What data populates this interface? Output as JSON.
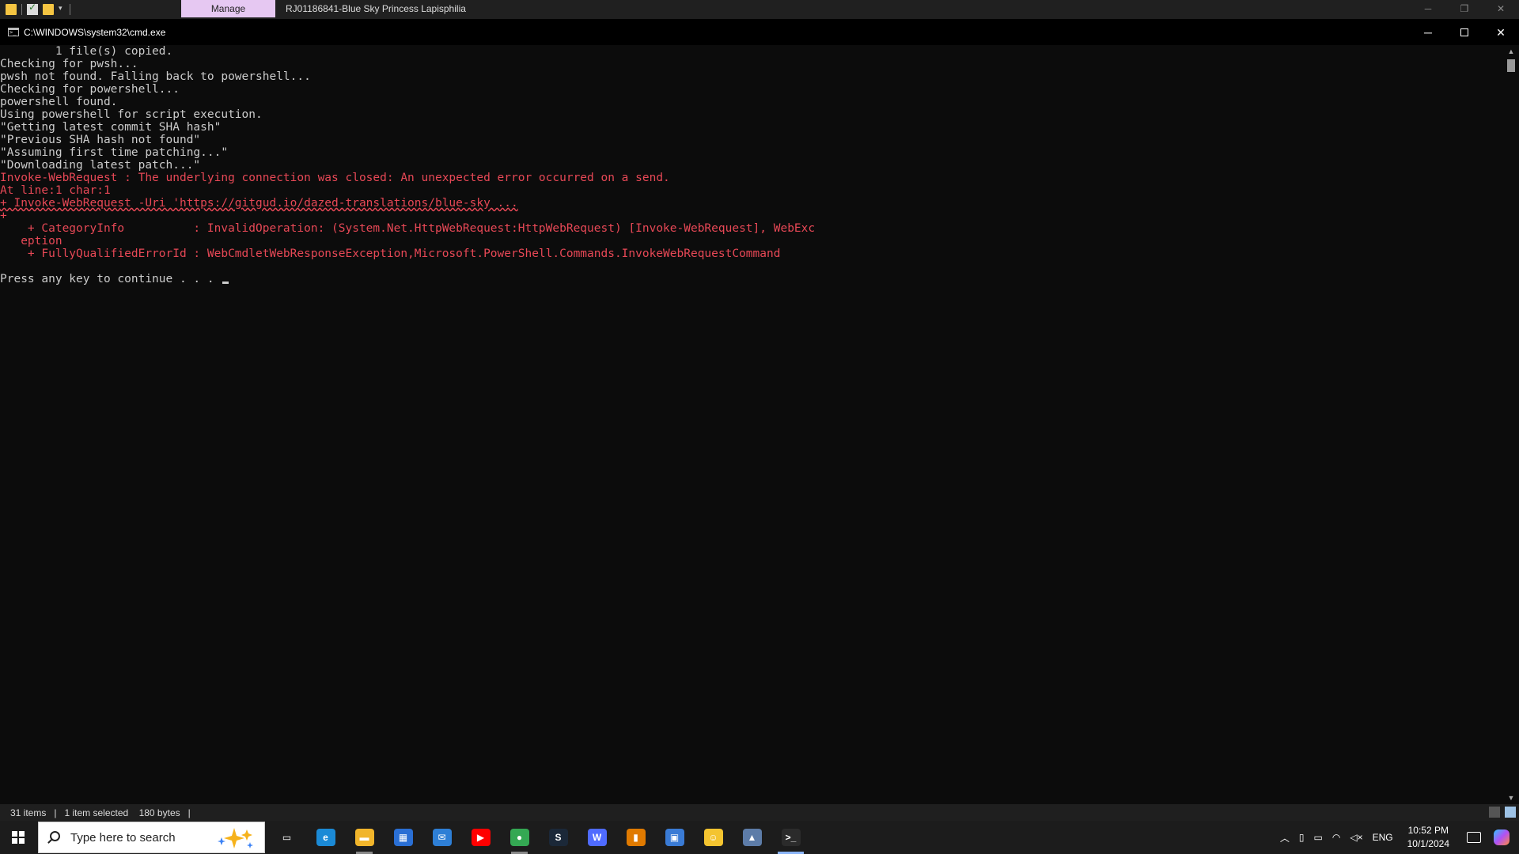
{
  "explorer": {
    "manage_tab": "Manage",
    "title": "RJ01186841-Blue Sky Princess Lapisphilia"
  },
  "cmd": {
    "title": "C:\\WINDOWS\\system32\\cmd.exe",
    "lines": [
      {
        "text": "        1 file(s) copied.",
        "color": "#cccccc"
      },
      {
        "text": "Checking for pwsh...",
        "color": "#cccccc"
      },
      {
        "text": "pwsh not found. Falling back to powershell...",
        "color": "#cccccc"
      },
      {
        "text": "Checking for powershell...",
        "color": "#cccccc"
      },
      {
        "text": "powershell found.",
        "color": "#cccccc"
      },
      {
        "text": "Using powershell for script execution.",
        "color": "#cccccc"
      },
      {
        "text": "\"Getting latest commit SHA hash\"",
        "color": "#cccccc"
      },
      {
        "text": "\"Previous SHA hash not found\"",
        "color": "#cccccc"
      },
      {
        "text": "\"Assuming first time patching...\"",
        "color": "#cccccc"
      },
      {
        "text": "\"Downloading latest patch...\"",
        "color": "#cccccc"
      },
      {
        "text": "Invoke-WebRequest : The underlying connection was closed: An unexpected error occurred on a send.",
        "color": "#e74856"
      },
      {
        "text": "At line:1 char:1",
        "color": "#e74856"
      },
      {
        "text": "+ Invoke-WebRequest -Uri 'https://gitgud.io/dazed-translations/blue-sky ...",
        "color": "#e74856"
      },
      {
        "text": "+",
        "color": "#e74856"
      },
      {
        "text": "    + CategoryInfo          : InvalidOperation: (System.Net.HttpWebRequest:HttpWebRequest) [Invoke-WebRequest], WebExc",
        "color": "#e74856"
      },
      {
        "text": "   eption",
        "color": "#e74856"
      },
      {
        "text": "    + FullyQualifiedErrorId : WebCmdletWebResponseException,Microsoft.PowerShell.Commands.InvokeWebRequestCommand",
        "color": "#e74856"
      },
      {
        "text": "",
        "color": "#cccccc"
      },
      {
        "text": "Press any key to continue . . . ",
        "color": "#cccccc",
        "cursor": true
      }
    ]
  },
  "statusbar": {
    "items_count": "31 items",
    "selected": "1 item selected",
    "size": "180 bytes"
  },
  "taskbar": {
    "search_placeholder": "Type here to search",
    "apps": [
      {
        "name": "task-view",
        "glyph": "▭",
        "bg": "transparent"
      },
      {
        "name": "edge",
        "glyph": "e",
        "bg": "#1b8ad6"
      },
      {
        "name": "file-explorer",
        "glyph": "▬",
        "bg": "#f1b52b",
        "state": "running"
      },
      {
        "name": "microsoft-store",
        "glyph": "▦",
        "bg": "#2a6fd4"
      },
      {
        "name": "mail",
        "glyph": "✉",
        "bg": "#2e7fd6"
      },
      {
        "name": "youtube",
        "glyph": "▶",
        "bg": "#ff0000"
      },
      {
        "name": "chrome",
        "glyph": "●",
        "bg": "#34a853",
        "state": "running"
      },
      {
        "name": "steam",
        "glyph": "S",
        "bg": "#1b2838"
      },
      {
        "name": "app-purple",
        "glyph": "W",
        "bg": "#4f6bff"
      },
      {
        "name": "app-orange",
        "glyph": "▮",
        "bg": "#e07a00"
      },
      {
        "name": "app-window",
        "glyph": "▣",
        "bg": "#3a7bd5"
      },
      {
        "name": "app-yellow",
        "glyph": "☺",
        "bg": "#f4c430"
      },
      {
        "name": "photos",
        "glyph": "▲",
        "bg": "#5d7ca8"
      },
      {
        "name": "terminal",
        "glyph": ">_",
        "bg": "#2b2b2b",
        "state": "active"
      }
    ],
    "tray": {
      "language": "ENG",
      "time": "10:52 PM",
      "date": "10/1/2024"
    }
  }
}
